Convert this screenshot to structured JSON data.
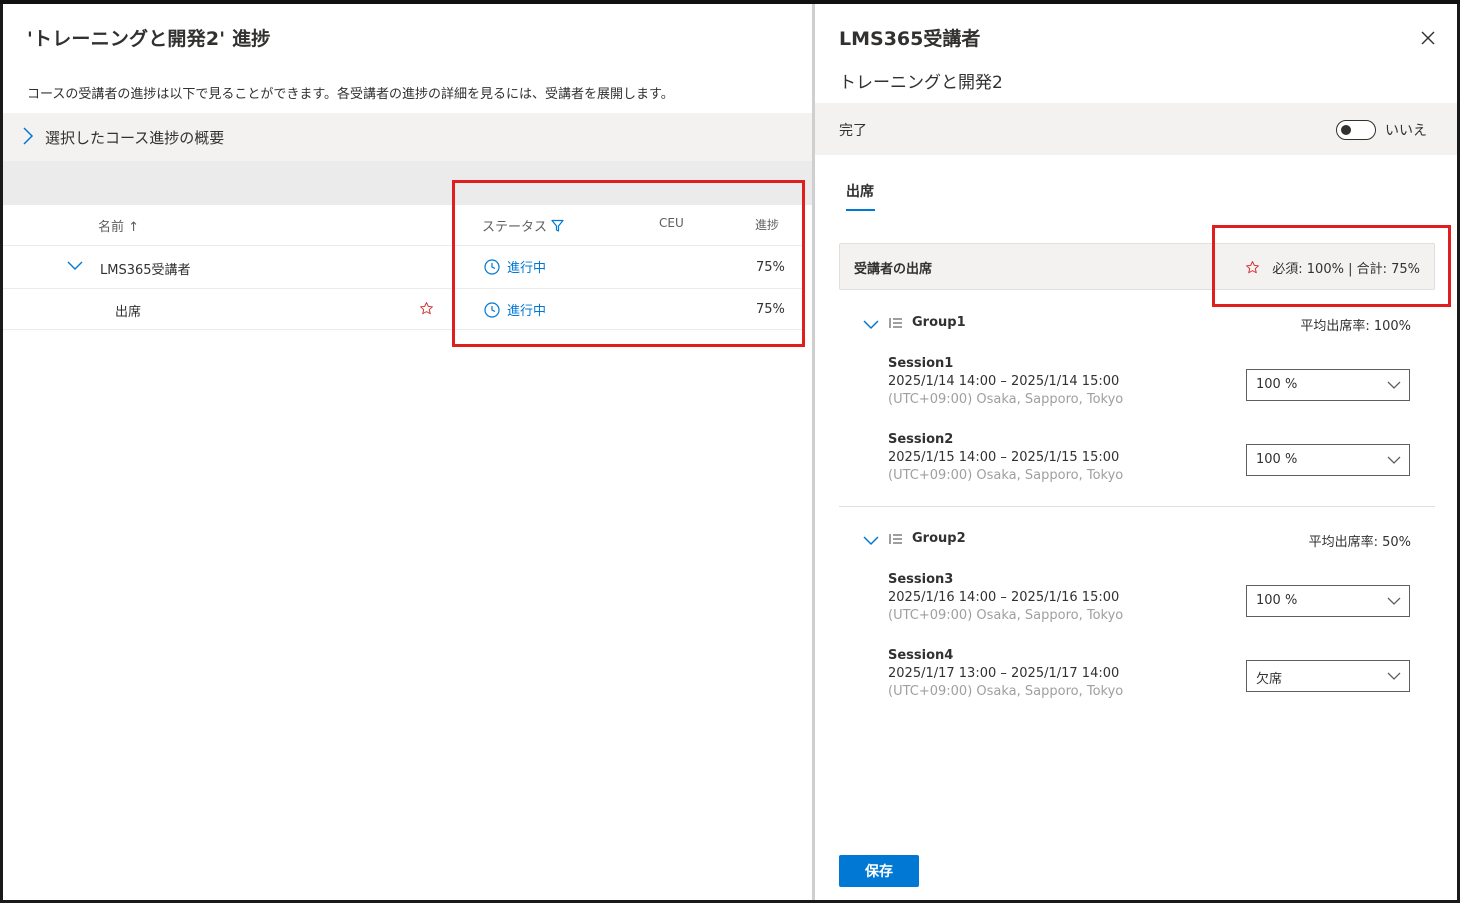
{
  "left": {
    "title": "'トレーニングと開発2' 進捗",
    "description": "コースの受講者の進捗は以下で見ることができます。各受講者の進捗の詳細を見るには、受講者を展開します。",
    "summary_label": "選択したコース進捗の概要",
    "columns": {
      "name": "名前 ↑",
      "status": "ステータス",
      "ceu": "CEU",
      "progress": "進捗"
    },
    "rows": [
      {
        "name": "LMS365受講者",
        "status": "進行中",
        "progress": "75%"
      },
      {
        "name": "出席",
        "status": "進行中",
        "progress": "75%"
      }
    ]
  },
  "panel": {
    "title": "LMS365受講者",
    "subtitle": "トレーニングと開発2",
    "complete_label": "完了",
    "toggle_label": "いいえ",
    "tab_label": "出席",
    "attendance_title": "受講者の出席",
    "attendance_summary": "必須: 100% | 合計: 75%",
    "groups": [
      {
        "name": "Group1",
        "rate": "平均出席率: 100%",
        "sessions": [
          {
            "title": "Session1",
            "time": "2025/1/14 14:00 – 2025/1/14 15:00",
            "tz": "(UTC+09:00) Osaka, Sapporo, Tokyo",
            "value": "100 %"
          },
          {
            "title": "Session2",
            "time": "2025/1/15 14:00 – 2025/1/15 15:00",
            "tz": "(UTC+09:00) Osaka, Sapporo, Tokyo",
            "value": "100 %"
          }
        ]
      },
      {
        "name": "Group2",
        "rate": "平均出席率: 50%",
        "sessions": [
          {
            "title": "Session3",
            "time": "2025/1/16 14:00 – 2025/1/16 15:00",
            "tz": "(UTC+09:00) Osaka, Sapporo, Tokyo",
            "value": "100 %"
          },
          {
            "title": "Session4",
            "time": "2025/1/17 13:00 – 2025/1/17 14:00",
            "tz": "(UTC+09:00) Osaka, Sapporo, Tokyo",
            "value": "欠席"
          }
        ]
      }
    ],
    "save_label": "保存"
  },
  "colors": {
    "accent": "#0078d4",
    "highlight_box": "#e01e1e",
    "star": "#d13438"
  },
  "icons": [
    "chevron-right-icon",
    "filter-icon",
    "chevron-down-icon",
    "clock-icon",
    "star-icon",
    "close-icon",
    "list-icon"
  ]
}
